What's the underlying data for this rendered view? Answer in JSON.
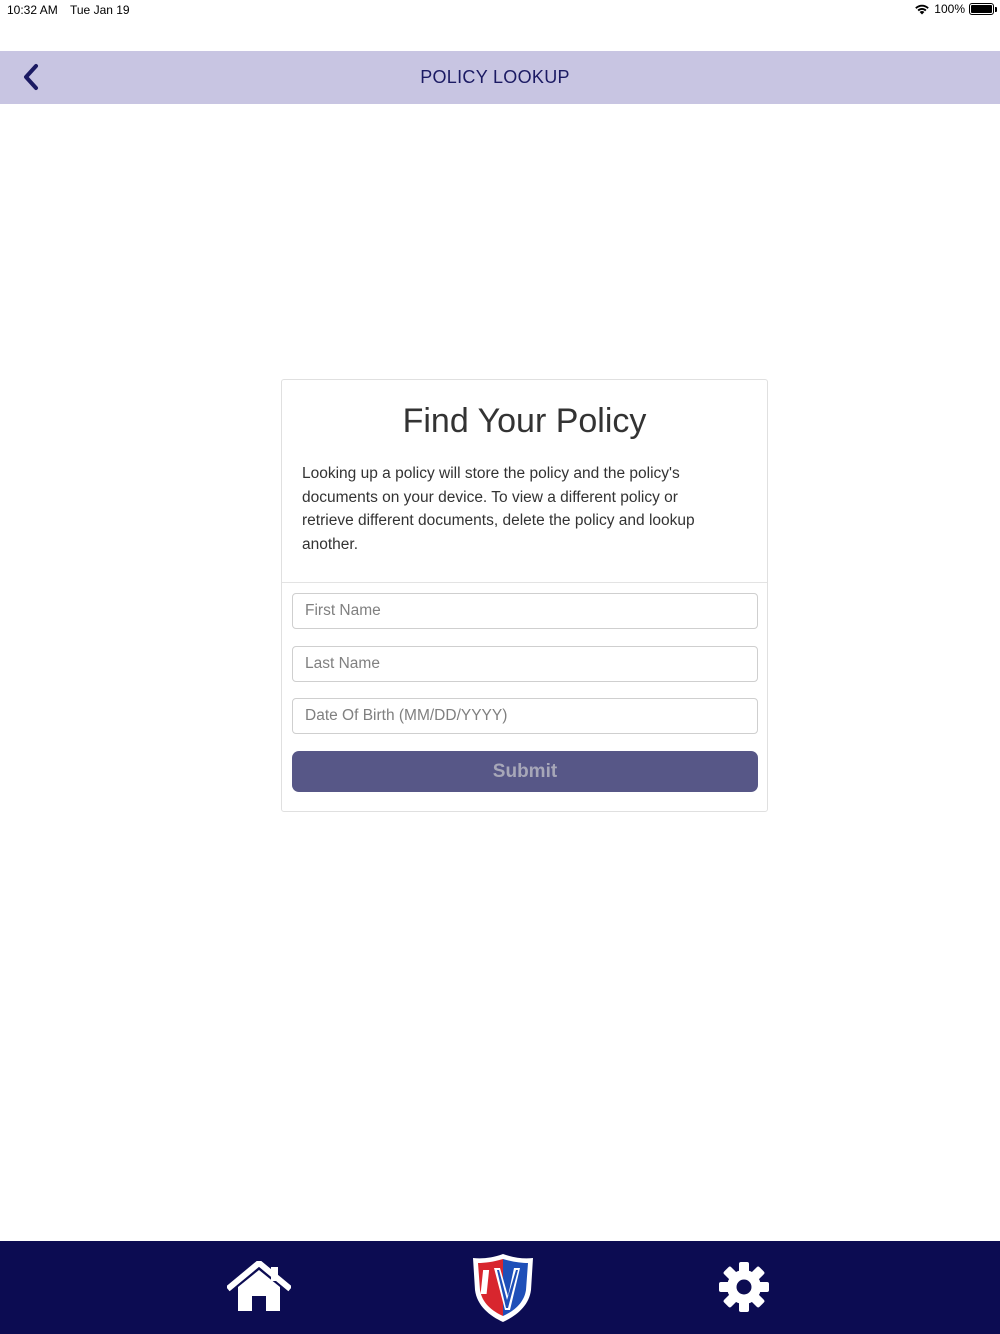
{
  "status_bar": {
    "time": "10:32 AM",
    "date": "Tue Jan 19",
    "battery": "100%"
  },
  "header": {
    "title": "POLICY LOOKUP",
    "back_icon": "chevron-left-icon"
  },
  "card": {
    "title": "Find Your Policy",
    "description": "Looking up a policy will store the policy and the policy's documents on your device. To view a different policy or retrieve different documents, delete the policy and lookup another.",
    "fields": {
      "first_name": {
        "placeholder": "First Name",
        "value": ""
      },
      "last_name": {
        "placeholder": "Last Name",
        "value": ""
      },
      "dob": {
        "placeholder": "Date Of Birth (MM/DD/YYYY)",
        "value": ""
      }
    },
    "submit_label": "Submit"
  },
  "bottom_nav": {
    "items": [
      {
        "icon": "home-icon"
      },
      {
        "icon": "shield-logo-icon"
      },
      {
        "icon": "gear-icon"
      }
    ]
  },
  "colors": {
    "header_bg": "#c8c5e2",
    "header_text": "#1b1a63",
    "nav_bg": "#0c0c52",
    "submit_bg": "#575787",
    "submit_text": "#a7a7b8",
    "logo_red": "#d8262e",
    "logo_blue": "#1e4fb8"
  }
}
